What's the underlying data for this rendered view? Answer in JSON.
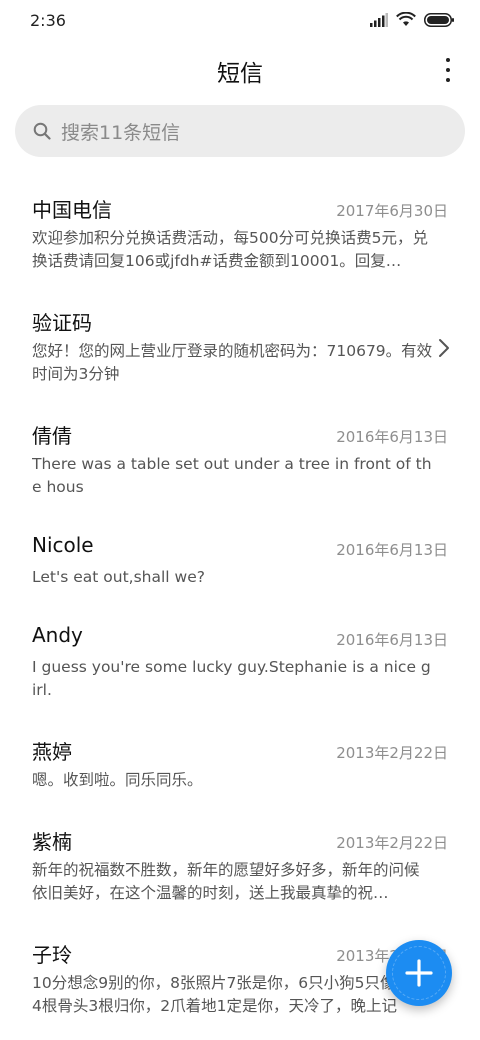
{
  "status_bar": {
    "time": "2:36",
    "signal_icon": "signal-icon",
    "wifi_icon": "wifi-icon",
    "battery_icon": "battery-icon"
  },
  "header": {
    "title": "短信",
    "more_icon": "more-vertical-icon"
  },
  "search": {
    "placeholder": "搜索11条短信",
    "icon": "search-icon"
  },
  "messages": [
    {
      "name": "中国电信",
      "date": "2017年6月30日",
      "preview": "欢迎参加积分兑换话费活动，每500分可兑换话费5元，兑换话费请回复106或jfdh#话费金额到10001。回复…"
    },
    {
      "name": "验证码",
      "date": "",
      "preview": "您好！您的网上营业厅登录的随机密码为：710679。有效时间为3分钟"
    },
    {
      "name": "倩倩",
      "date": "2016年6月13日",
      "preview": "There was a table set out under a tree in front of the hous"
    },
    {
      "name": "Nicole",
      "date": "2016年6月13日",
      "preview": "Let's eat out,shall we?"
    },
    {
      "name": "Andy",
      "date": "2016年6月13日",
      "preview": "I guess you're some lucky guy.Stephanie is a nice girl."
    },
    {
      "name": "燕婷",
      "date": "2013年2月22日",
      "preview": "嗯。收到啦。同乐同乐。"
    },
    {
      "name": "紫楠",
      "date": "2013年2月22日",
      "preview": "新年的祝福数不胜数，新年的愿望好多好多，新年的问候依旧美好，在这个温馨的时刻，送上我最真挚的祝…"
    },
    {
      "name": "子玲",
      "date": "2013年2月22日",
      "preview": "10分想念9别的你，8张照片7张是你，6只小狗5只像你，4根骨头3根归你，2爪着地1定是你，天冷了，晚上记"
    }
  ],
  "fab": {
    "icon": "plus-icon",
    "color": "#1c8cf2"
  }
}
